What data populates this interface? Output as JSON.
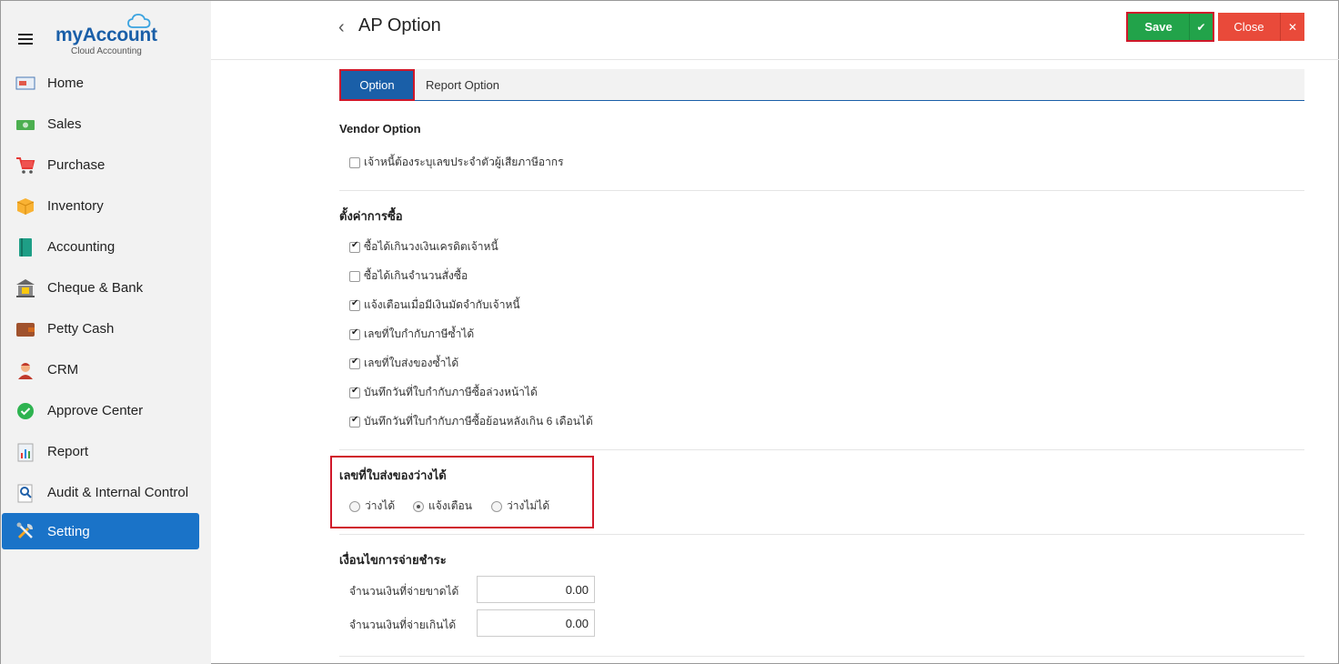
{
  "app": {
    "logo_title": "myAccount",
    "logo_subtitle": "Cloud Accounting"
  },
  "sidebar": {
    "items": [
      {
        "label": "Home",
        "icon": "home-icon"
      },
      {
        "label": "Sales",
        "icon": "sales-icon"
      },
      {
        "label": "Purchase",
        "icon": "cart-icon"
      },
      {
        "label": "Inventory",
        "icon": "box-icon"
      },
      {
        "label": "Accounting",
        "icon": "book-icon"
      },
      {
        "label": "Cheque & Bank",
        "icon": "bank-icon"
      },
      {
        "label": "Petty Cash",
        "icon": "wallet-icon"
      },
      {
        "label": "CRM",
        "icon": "crm-icon"
      },
      {
        "label": "Approve Center",
        "icon": "approve-icon"
      },
      {
        "label": "Report",
        "icon": "report-icon"
      },
      {
        "label": "Audit & Internal Control",
        "icon": "audit-icon"
      },
      {
        "label": "Setting",
        "icon": "settings-icon"
      }
    ],
    "active": "Setting"
  },
  "header": {
    "title": "AP Option",
    "save_label": "Save",
    "close_label": "Close"
  },
  "tabs": [
    {
      "label": "Option",
      "active": true
    },
    {
      "label": "Report Option",
      "active": false
    }
  ],
  "vendor_option": {
    "title": "Vendor Option",
    "items": [
      {
        "label": "เจ้าหนี้ต้องระบุเลขประจำตัวผู้เสียภาษีอากร",
        "checked": false
      }
    ]
  },
  "purchase_settings": {
    "title": "ตั้งค่าการซื้อ",
    "items": [
      {
        "label": "ซื้อได้เกินวงเงินเครดิตเจ้าหนี้",
        "checked": true
      },
      {
        "label": "ซื้อได้เกินจำนวนสั่งซื้อ",
        "checked": false
      },
      {
        "label": "แจ้งเตือนเมื่อมีเงินมัดจำกับเจ้าหนี้",
        "checked": true
      },
      {
        "label": "เลขที่ใบกำกับภาษีซ้ำได้",
        "checked": true
      },
      {
        "label": "เลขที่ใบส่งของซ้ำได้",
        "checked": true
      },
      {
        "label": "บันทึกวันที่ใบกำกับภาษีซื้อล่วงหน้าได้",
        "checked": true
      },
      {
        "label": "บันทึกวันที่ใบกำกับภาษีซื้อย้อนหลังเกิน 6 เดือนได้",
        "checked": true
      }
    ]
  },
  "delivery_blank": {
    "title": "เลขที่ใบส่งของว่างได้",
    "options": [
      {
        "label": "ว่างได้",
        "selected": false
      },
      {
        "label": "แจ้งเตือน",
        "selected": true
      },
      {
        "label": "ว่างไม่ได้",
        "selected": false
      }
    ]
  },
  "payment_terms": {
    "title": "เงื่อนไขการจ่ายชำระ",
    "underpay_label": "จำนวนเงินที่จ่ายขาดได้",
    "underpay_value": "0.00",
    "overpay_label": "จำนวนเงินที่จ่ายเกินได้",
    "overpay_value": "0.00"
  },
  "colors": {
    "accent": "#1a73c8",
    "save": "#22a34a",
    "close": "#e94a3a",
    "highlight": "#d0182a"
  }
}
